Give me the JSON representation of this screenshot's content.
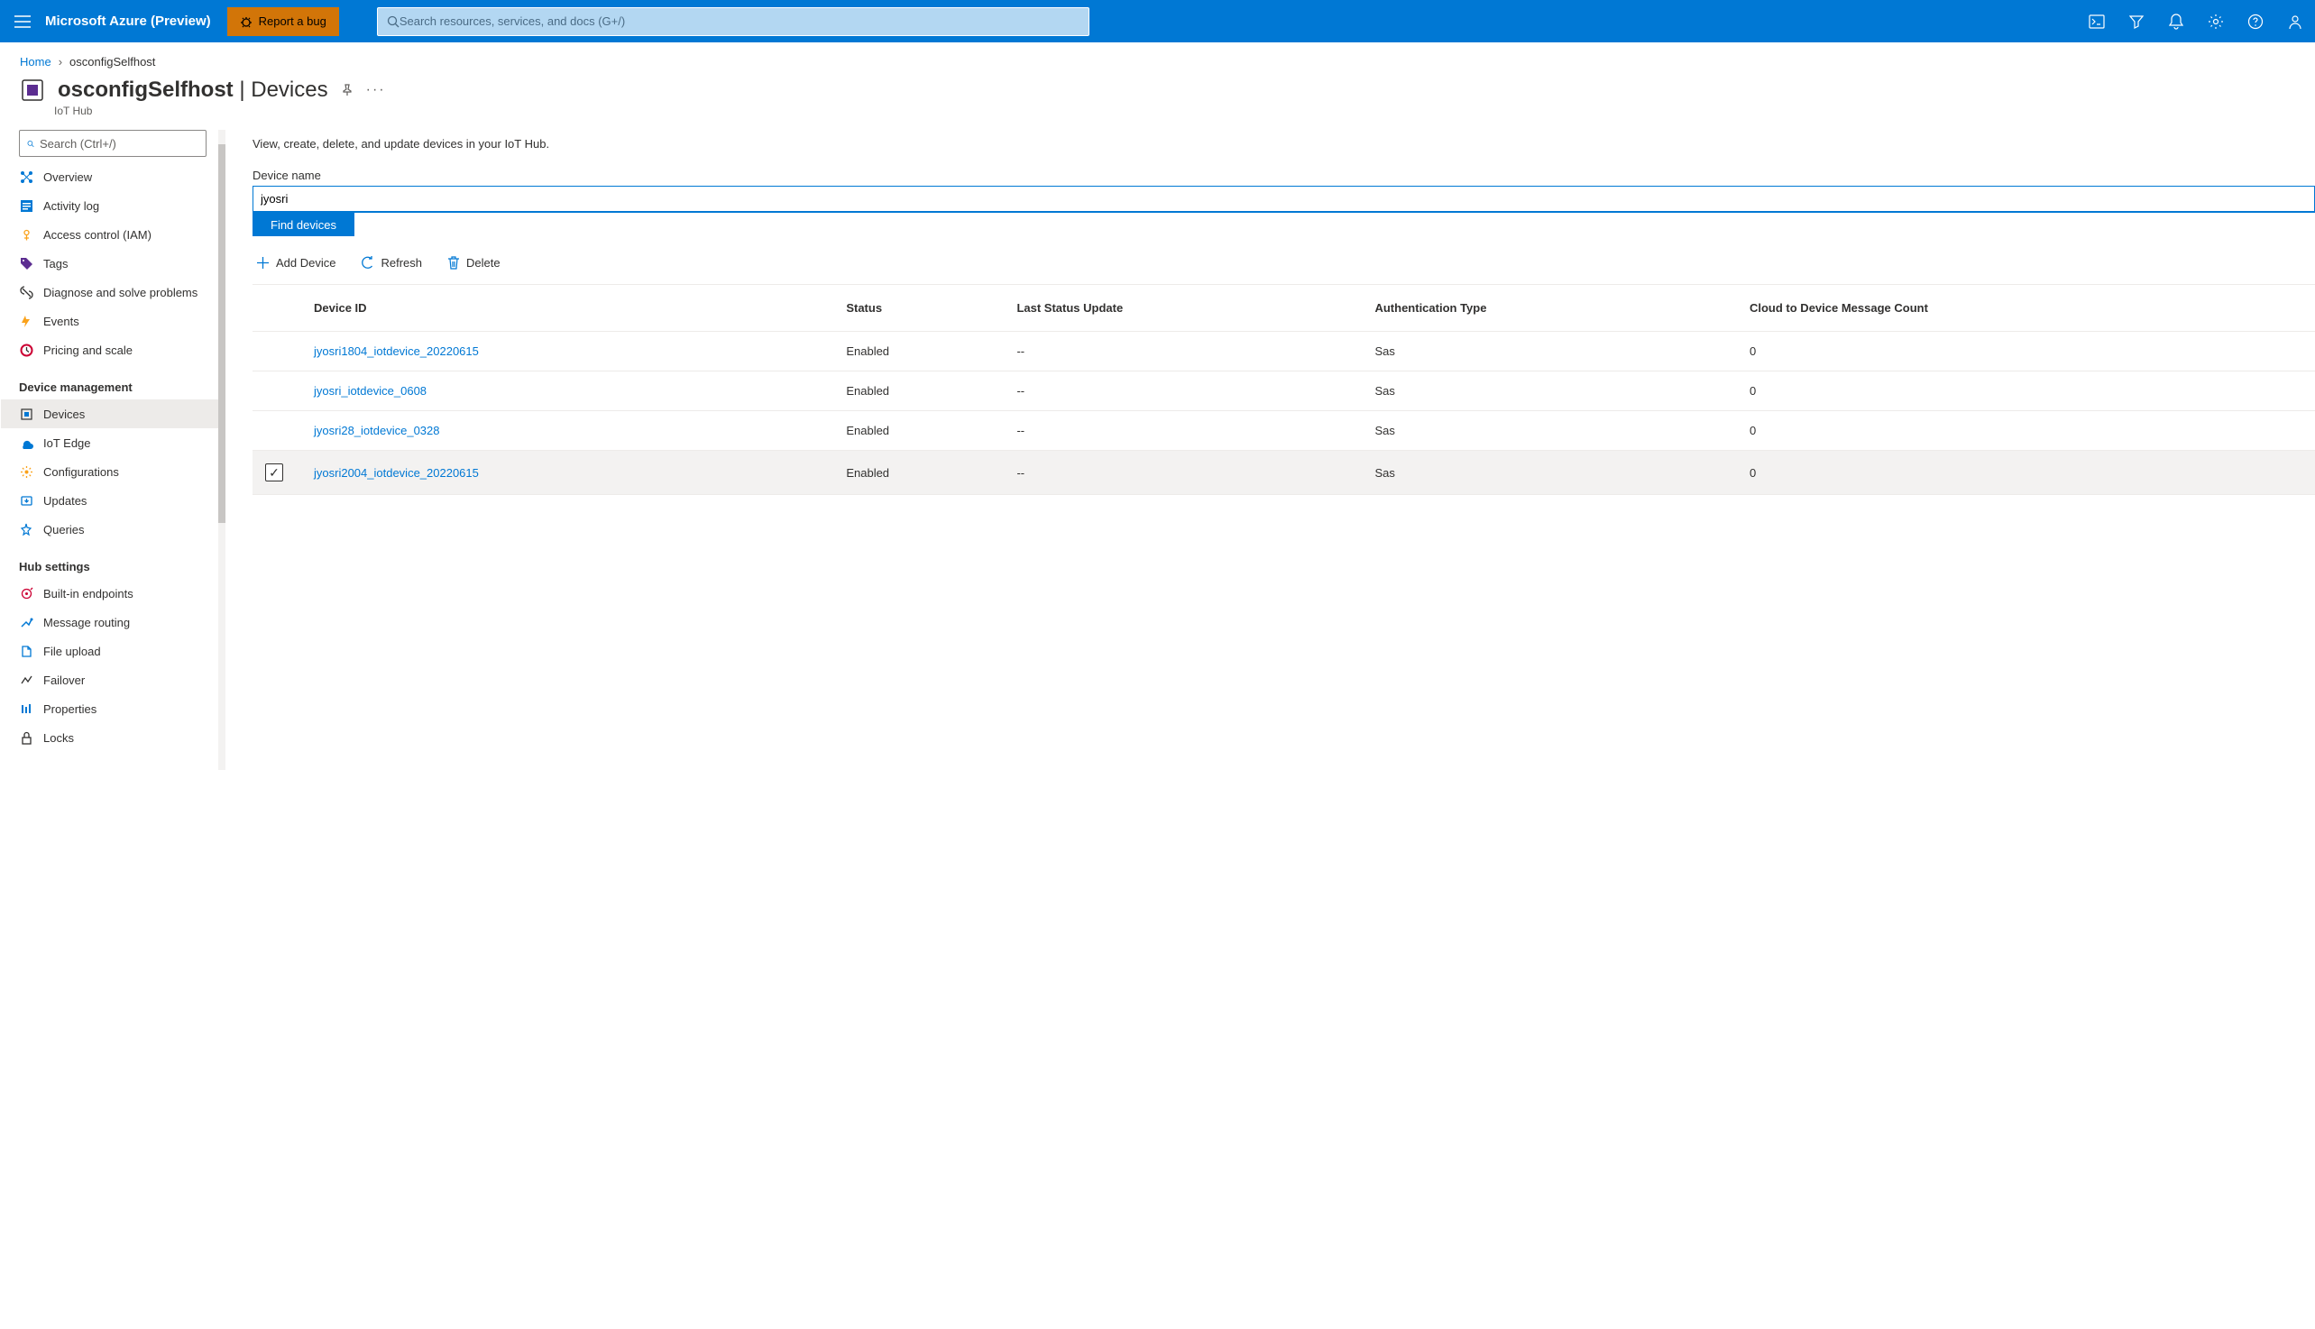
{
  "topbar": {
    "brand": "Microsoft Azure (Preview)",
    "bug_label": "Report a bug",
    "search_placeholder": "Search resources, services, and docs (G+/)"
  },
  "breadcrumb": {
    "home": "Home",
    "current": "osconfigSelfhost"
  },
  "title": {
    "resource": "osconfigSelfhost",
    "section": "Devices",
    "subtitle": "IoT Hub"
  },
  "sidebar": {
    "search_placeholder": "Search (Ctrl+/)",
    "items_general": [
      {
        "label": "Overview",
        "icon": "overview"
      },
      {
        "label": "Activity log",
        "icon": "activity"
      },
      {
        "label": "Access control (IAM)",
        "icon": "access"
      },
      {
        "label": "Tags",
        "icon": "tags"
      },
      {
        "label": "Diagnose and solve problems",
        "icon": "diagnose"
      },
      {
        "label": "Events",
        "icon": "events"
      },
      {
        "label": "Pricing and scale",
        "icon": "pricing"
      }
    ],
    "group_device": "Device management",
    "items_device": [
      {
        "label": "Devices",
        "icon": "devices",
        "active": true
      },
      {
        "label": "IoT Edge",
        "icon": "edge"
      },
      {
        "label": "Configurations",
        "icon": "config"
      },
      {
        "label": "Updates",
        "icon": "updates"
      },
      {
        "label": "Queries",
        "icon": "queries"
      }
    ],
    "group_hub": "Hub settings",
    "items_hub": [
      {
        "label": "Built-in endpoints",
        "icon": "endpoints"
      },
      {
        "label": "Message routing",
        "icon": "routing"
      },
      {
        "label": "File upload",
        "icon": "upload"
      },
      {
        "label": "Failover",
        "icon": "failover"
      },
      {
        "label": "Properties",
        "icon": "properties"
      },
      {
        "label": "Locks",
        "icon": "locks"
      }
    ]
  },
  "main": {
    "desc": "View, create, delete, and update devices in your IoT Hub.",
    "device_name_label": "Device name",
    "device_name_value": "jyosri",
    "find_label": "Find devices",
    "toolbar": {
      "add": "Add Device",
      "refresh": "Refresh",
      "delete": "Delete"
    },
    "columns": [
      "Device ID",
      "Status",
      "Last Status Update",
      "Authentication Type",
      "Cloud to Device Message Count"
    ],
    "rows": [
      {
        "id": "jyosri1804_iotdevice_20220615",
        "status": "Enabled",
        "update": "--",
        "auth": "Sas",
        "count": "0",
        "hover": false
      },
      {
        "id": "jyosri_iotdevice_0608",
        "status": "Enabled",
        "update": "--",
        "auth": "Sas",
        "count": "0",
        "hover": false
      },
      {
        "id": "jyosri28_iotdevice_0328",
        "status": "Enabled",
        "update": "--",
        "auth": "Sas",
        "count": "0",
        "hover": false
      },
      {
        "id": "jyosri2004_iotdevice_20220615",
        "status": "Enabled",
        "update": "--",
        "auth": "Sas",
        "count": "0",
        "hover": true
      }
    ]
  }
}
